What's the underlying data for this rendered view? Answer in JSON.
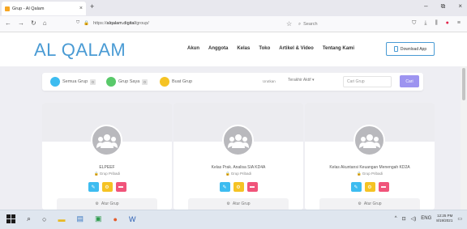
{
  "browser": {
    "tab_title": "Grup - Al Qalam",
    "tab_close": "×",
    "new_tab": "+",
    "url_prefix": "https://",
    "url_host": "alqalam.digital",
    "url_path": "/group/",
    "search_placeholder": "Search",
    "window_controls": [
      "–",
      "⧉",
      "×"
    ]
  },
  "site": {
    "logo": "AL QALAM",
    "menu": [
      "Akun",
      "Anggota",
      "Kelas",
      "Toko",
      "Artikel & Video",
      "Tentang Kami"
    ],
    "download_label": "Download App"
  },
  "filters": {
    "semua_label": "Semua Grup",
    "semua_count": "0",
    "saya_label": "Grup Saya",
    "saya_count": "0",
    "buat_label": "Buat Grup",
    "sort_label": "Urutkan",
    "sort_value": "Terakhir Aktif",
    "search_placeholder": "Cari Grup",
    "search_button": "Cari"
  },
  "groups": [
    {
      "name": "ELPEEF",
      "type": "Grup Pribadi",
      "manage_label": "Atur Grup"
    },
    {
      "name": "Kelas Prak. Analisa SIA KD4A",
      "type": "Grup Pribadi",
      "manage_label": "Atur Grup"
    },
    {
      "name": "Kelas Akuntansi Keuangan Menengah KD2A",
      "type": "Grup Pribadi",
      "manage_label": "Atur Grup"
    }
  ],
  "taskbar": {
    "lang": "ENG",
    "time": "12:25 PM",
    "date": "8/19/2021"
  },
  "colors": {
    "brand": "#4a9bd4",
    "filter_blue": "#3dbcf0",
    "filter_green": "#59c96a",
    "filter_yellow": "#f5c324",
    "action_pink": "#f0547a",
    "cari_button": "#9d94f0"
  }
}
